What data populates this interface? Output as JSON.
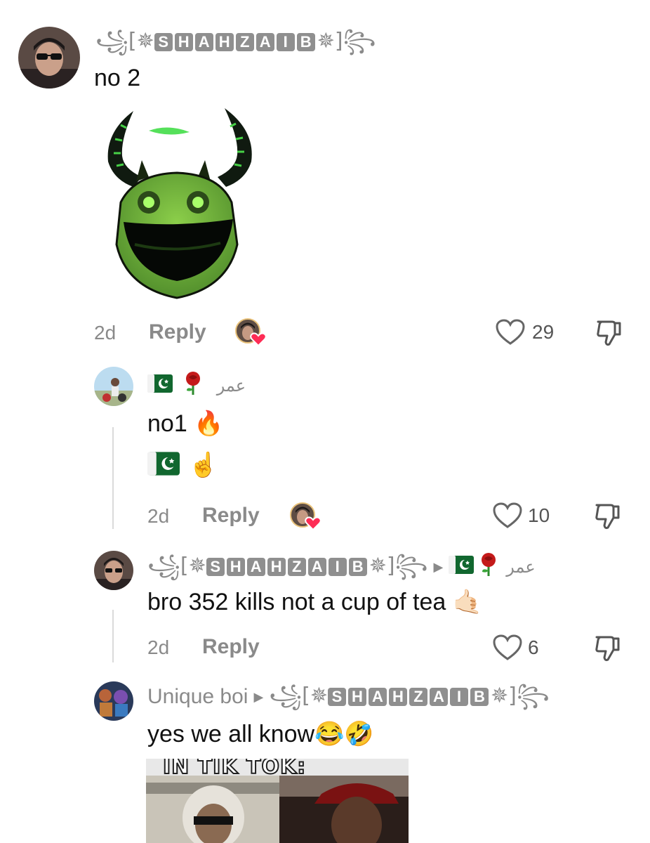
{
  "comments": [
    {
      "username_letters": [
        "S",
        "H",
        "A",
        "H",
        "Z",
        "A",
        "I",
        "B"
      ],
      "text": "no 2",
      "time": "2d",
      "reply_label": "Reply",
      "likes": "29"
    },
    {
      "username_suffix": "عمر",
      "text_line1": "no1 🔥",
      "text_line2": "☝️",
      "time": "2d",
      "reply_label": "Reply",
      "likes": "10"
    },
    {
      "username_letters": [
        "S",
        "H",
        "A",
        "H",
        "Z",
        "A",
        "I",
        "B"
      ],
      "reply_to_suffix": "عمر",
      "text": "bro 352 kills not a cup of tea 🤙🏻",
      "time": "2d",
      "reply_label": "Reply",
      "likes": "6"
    },
    {
      "username": "Unique boi",
      "reply_to_letters": [
        "S",
        "H",
        "A",
        "H",
        "Z",
        "A",
        "I",
        "B"
      ],
      "text": "yes we all know😂🤣",
      "image_caption": "IN TIK TOK:"
    }
  ],
  "colors": {
    "muted": "#8a8a8a",
    "heart_badge": "#fe2c55",
    "text": "#111111"
  },
  "icons": [
    "heart-outline-icon",
    "thumbs-down-icon",
    "pakistan-flag-icon",
    "rose-icon",
    "creator-liked-badge-icon"
  ]
}
